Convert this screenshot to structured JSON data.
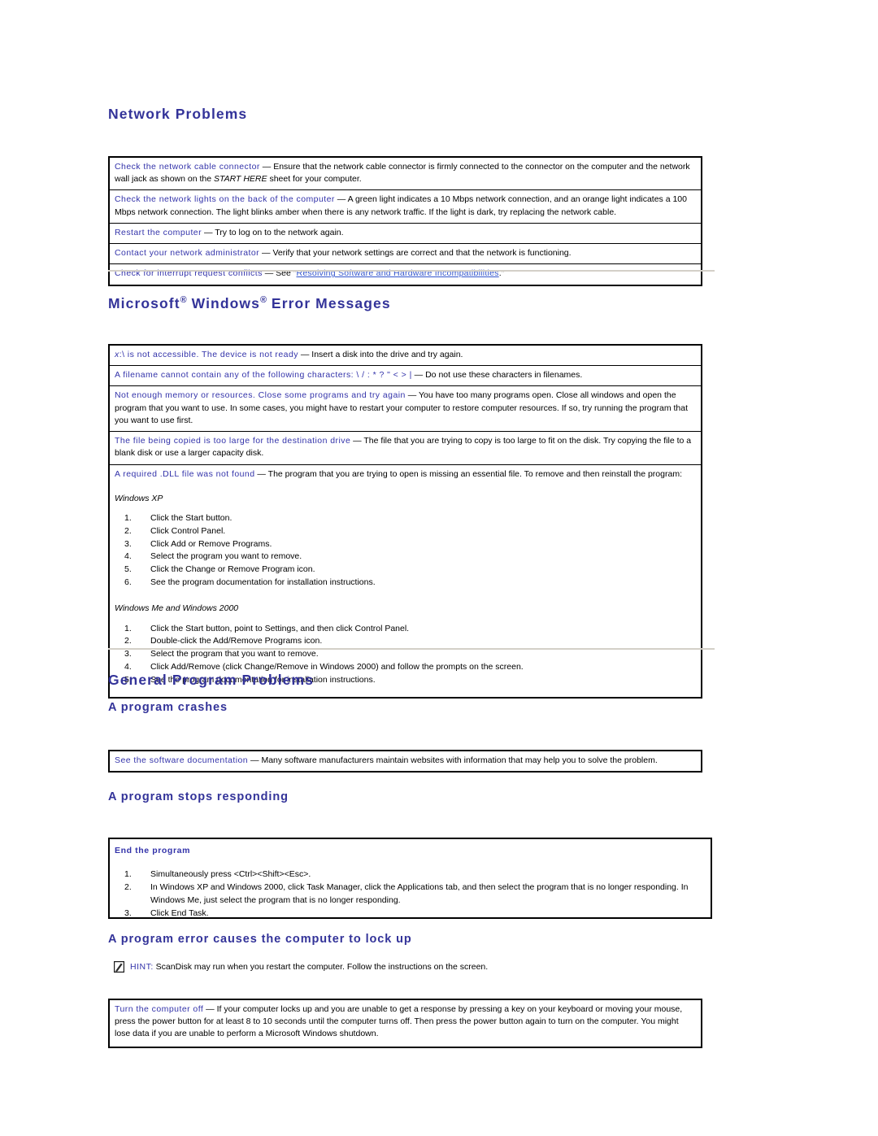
{
  "document": {
    "sections": [
      {
        "id": "network-problems",
        "title": "Network Problems",
        "rows": [
          {
            "lead": "Check the network cable connector",
            "body_1": " — Ensure that the network cable connector is firmly connected to the connector on the computer and the network wall jack as shown on the ",
            "italic": "START HERE",
            "body_2": " sheet for your computer."
          },
          {
            "lead": "Check the network lights on the back of the computer",
            "body_1": " — A green light indicates a 10 Mbps network connection, and an orange light indicates a 100 Mbps network connection. The light blinks amber when there is any network traffic. If the light is dark, try replacing the network cable."
          },
          {
            "lead": "Restart the computer",
            "body_1": " — Try to log on to the network again."
          },
          {
            "lead": "Contact your network administrator",
            "body_1": " — Verify that your network settings are correct and that the network is functioning."
          },
          {
            "lead": "Check for interrupt request conflicts",
            "body_1": " — See \"",
            "link": "Resolving Software and Hardware Incompatibilities",
            "body_2": ".\""
          }
        ]
      },
      {
        "id": "windows-error-messages",
        "title_part_1": "Microsoft",
        "title_reg_1": "®",
        "title_part_2": " Windows",
        "title_reg_2": "®",
        "title_part_3": " Error Messages",
        "rows": [
          {
            "lead_italic_prefix": "x",
            "lead": ":\\ is not accessible. The device is not ready",
            "body_1": " — Insert a disk into the drive and try again."
          },
          {
            "lead": "A filename cannot contain any of the following characters: \\ / : * ? \" < > |",
            "body_1": " — Do not use these characters in filenames."
          },
          {
            "lead": "Not enough memory or resources. Close some programs and try again",
            "body_1": " — You have too many programs open. Close all windows and open the program that you want to use. In some cases, you might have to restart your computer to restore computer resources. If so, try running the program that you want to use first."
          },
          {
            "lead": "The file being copied is too large for the destination drive",
            "body_1": " — The file that you are trying to copy is too large to fit on the disk. Try copying the file to a blank disk or use a larger capacity disk."
          }
        ],
        "dll_row": {
          "lead": "A required .DLL file was not found",
          "body_1": " — The program that you are trying to open is missing an essential file. To remove and then reinstall the program:",
          "group_1": {
            "heading": "Windows XP",
            "steps": [
              "Click the Start button.",
              "Click Control Panel.",
              "Click Add or Remove Programs.",
              "Select the program you want to remove.",
              "Click the Change or Remove Program icon.",
              "See the program documentation for installation instructions."
            ]
          },
          "group_2": {
            "heading": "Windows Me and Windows 2000",
            "steps": [
              "Click the Start button, point to Settings, and then click Control Panel.",
              "Double-click the Add/Remove Programs icon.",
              "Select the program that you want to remove.",
              "Click Add/Remove (click Change/Remove in Windows 2000) and follow the prompts on the screen.",
              "See the program documentation for installation instructions."
            ]
          }
        }
      },
      {
        "id": "general-program-problems",
        "title": "General Program Problems",
        "sub_1": {
          "title": "A program crashes",
          "row": {
            "lead": "See the software documentation",
            "body_1": " — Many software manufacturers maintain websites with information that may help you to solve the problem."
          }
        },
        "sub_2": {
          "title": "A program stops responding",
          "panel": {
            "heading": "End the program",
            "steps": [
              "Simultaneously press <Ctrl><Shift><Esc>.",
              "In Windows XP and Windows 2000, click Task Manager, click the Applications tab, and then select the program that is no longer responding. In Windows Me, just select the program that is no longer responding.",
              "Click End Task."
            ]
          }
        },
        "sub_3": {
          "title": "A program error causes the computer to lock up",
          "hint": {
            "icon": "note-pencil-icon",
            "label": "HINT:",
            "text": " ScanDisk may run when you restart the computer. Follow the instructions on the screen."
          },
          "row": {
            "lead": "Turn the computer off",
            "body_1": " — If your computer locks up and you are unable to get a response by pressing a key on your keyboard or moving your mouse, press the power button for at least 8 to 10 seconds until the computer turns off. Then press the power button again to turn on the computer. You might lose data if you are unable to perform a Microsoft Windows shutdown."
          }
        }
      }
    ]
  },
  "colors": {
    "heading": "#333399",
    "lead": "#3333aa",
    "link": "#3355cc",
    "divider": "#d4d0c8",
    "border": "#000000"
  }
}
